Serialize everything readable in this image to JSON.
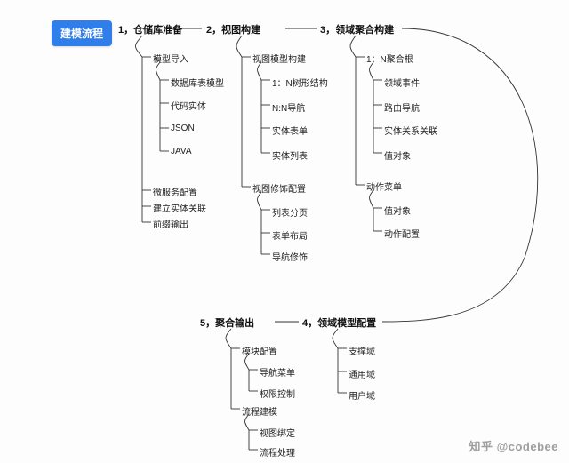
{
  "root": {
    "label": "建模流程",
    "accent": "#2f7eea"
  },
  "sections": {
    "s1": {
      "num": "1，",
      "title": "仓储库准备"
    },
    "s2": {
      "num": "2，",
      "title": "视图构建"
    },
    "s3": {
      "num": "3，",
      "title": "领域聚合构建"
    },
    "s4": {
      "num": "4，",
      "title": "领域模型配置"
    },
    "s5": {
      "num": "5，",
      "title": "聚合输出"
    }
  },
  "tree": {
    "s1": {
      "model_import": "模型导入",
      "model_import_children": {
        "data_table_model": "数据库表模型",
        "code_entity": "代码实体",
        "json": "JSON",
        "java": "JAVA"
      },
      "microservice_cfg": "微服务配置",
      "build_entity_rel": "建立实体关联",
      "prefix_output": "前缀输出"
    },
    "s2": {
      "view_model_build": "视图模型构建",
      "view_model_children": {
        "one_n_tree": "1：N树形结构",
        "n_n_nav": "N:N导航",
        "entity_form": "实体表单",
        "entity_list": "实体列表"
      },
      "view_decorate_cfg": "视图修饰配置",
      "view_decorate_children": {
        "list_paging": "列表分页",
        "form_block": "表单布局",
        "nav_decorate": "导航修饰"
      }
    },
    "s3": {
      "agg_root": "1：N聚合根",
      "agg_children": {
        "domain_event": "领域事件",
        "route_nav": "路由导航",
        "entity_rel": "实体关系关联",
        "value_obj": "值对象"
      },
      "action_menu": "动作菜单",
      "action_children": {
        "value_obj2": "值对象",
        "action_cfg": "动作配置"
      }
    },
    "s4": {
      "support_domain": "支撑域",
      "generic_domain": "通用域",
      "user_domain": "用户域"
    },
    "s5": {
      "module_cfg": "模块配置",
      "module_children": {
        "nav_menu": "导航菜单",
        "perm_ctrl": "权限控制"
      },
      "process_build": "流程建模",
      "process_children": {
        "view_bind": "视图绑定",
        "process_handle": "流程处理"
      }
    }
  },
  "watermark": "知乎 @codebee"
}
